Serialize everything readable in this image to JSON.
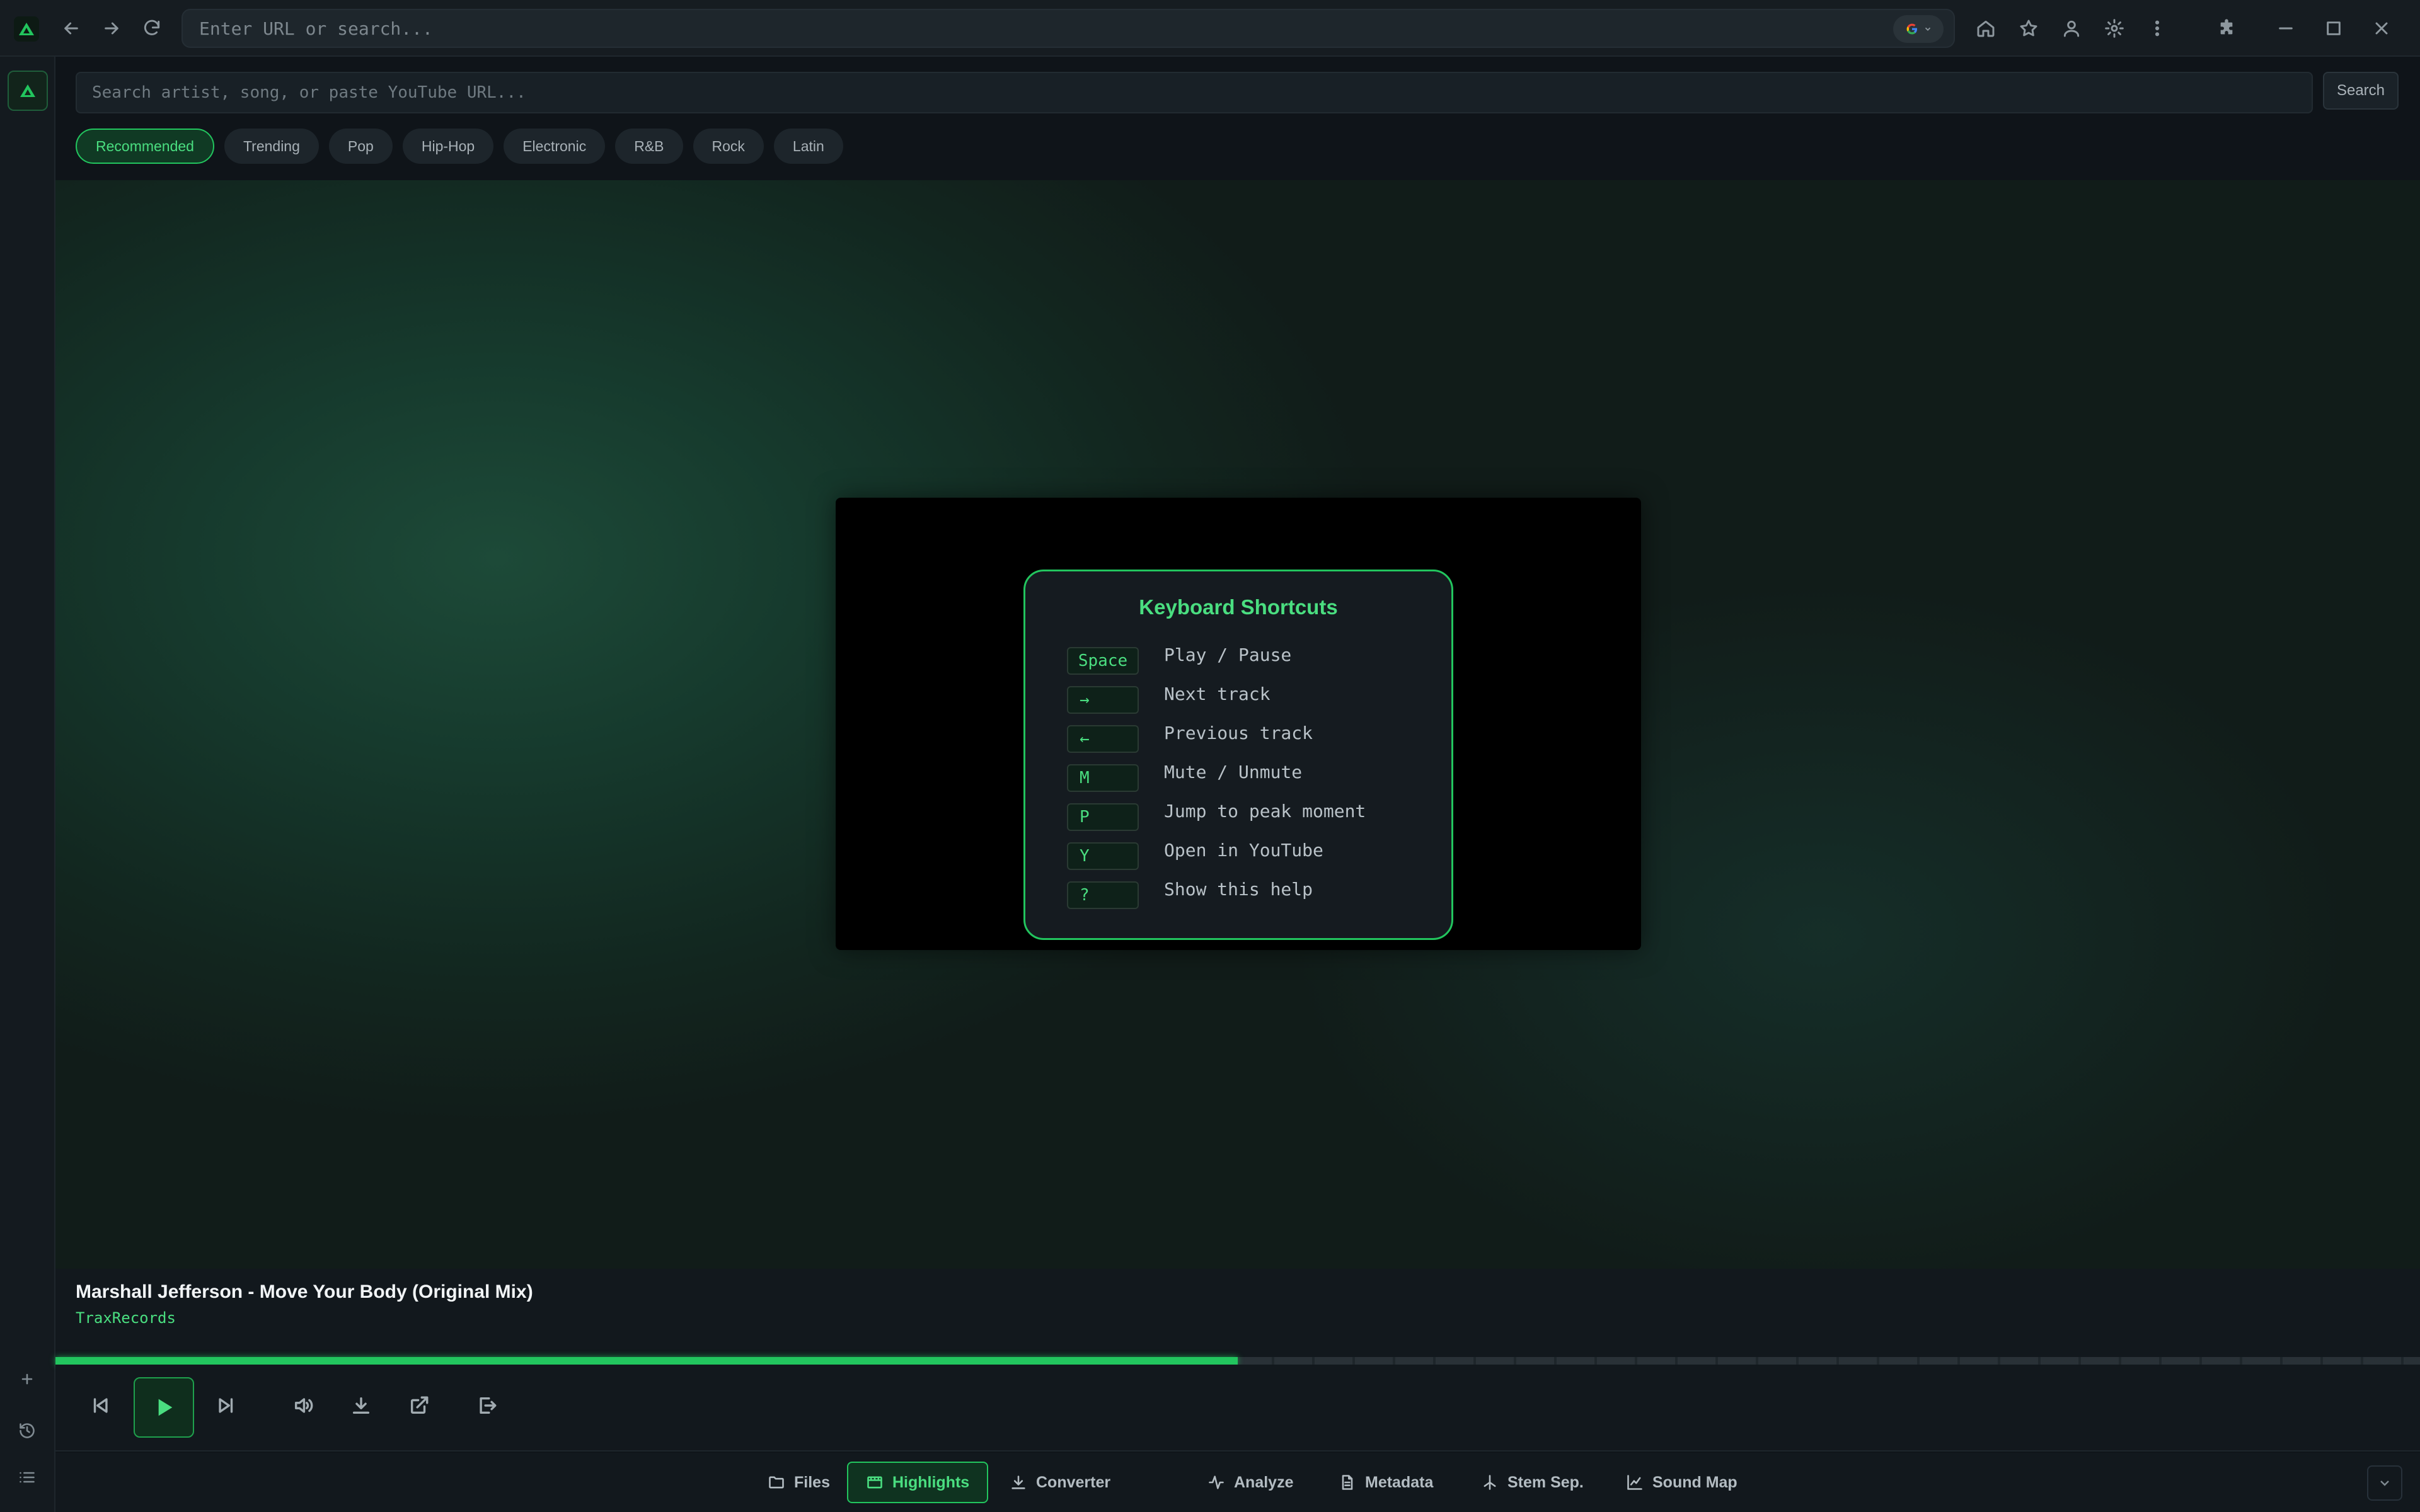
{
  "browser": {
    "url_placeholder": "Enter URL or search...",
    "icons": [
      "app-logo-icon",
      "back-icon",
      "forward-icon",
      "reload-icon",
      "google-icon",
      "home-icon",
      "star-icon",
      "profile-icon",
      "settings-icon",
      "more-icon",
      "extensions-icon",
      "minimize-icon",
      "maximize-icon",
      "close-icon"
    ]
  },
  "search": {
    "placeholder": "Search artist, song, or paste YouTube URL...",
    "button_label": "Search"
  },
  "genres": [
    {
      "label": "Recommended",
      "active": true
    },
    {
      "label": "Trending"
    },
    {
      "label": "Pop"
    },
    {
      "label": "Hip-Hop"
    },
    {
      "label": "Electronic"
    },
    {
      "label": "R&B"
    },
    {
      "label": "Rock"
    },
    {
      "label": "Latin"
    }
  ],
  "shortcuts": {
    "title": "Keyboard Shortcuts",
    "rows": [
      {
        "key": "Space",
        "desc": "Play / Pause"
      },
      {
        "key": "→",
        "desc": "Next track"
      },
      {
        "key": "←",
        "desc": "Previous track"
      },
      {
        "key": "M",
        "desc": "Mute / Unmute"
      },
      {
        "key": "P",
        "desc": "Jump to peak moment"
      },
      {
        "key": "Y",
        "desc": "Open in YouTube"
      },
      {
        "key": "?",
        "desc": "Show this help"
      }
    ]
  },
  "now_playing": {
    "title": "Marshall Jefferson - Move Your Body (Original Mix)",
    "channel": "TraxRecords",
    "progress": 0.5
  },
  "tabs": [
    {
      "label": "Files",
      "icon": "folder-icon"
    },
    {
      "label": "Highlights",
      "icon": "film-icon",
      "active": true
    },
    {
      "label": "Converter",
      "icon": "download-icon"
    },
    {
      "label": "Analyze",
      "icon": "activity-icon"
    },
    {
      "label": "Metadata",
      "icon": "file-icon"
    },
    {
      "label": "Stem Sep.",
      "icon": "split-icon"
    },
    {
      "label": "Sound Map",
      "icon": "chart-icon"
    }
  ],
  "colors": {
    "accent": "#22c55e",
    "accent_text": "#4ade80",
    "background": "#0f1419"
  }
}
